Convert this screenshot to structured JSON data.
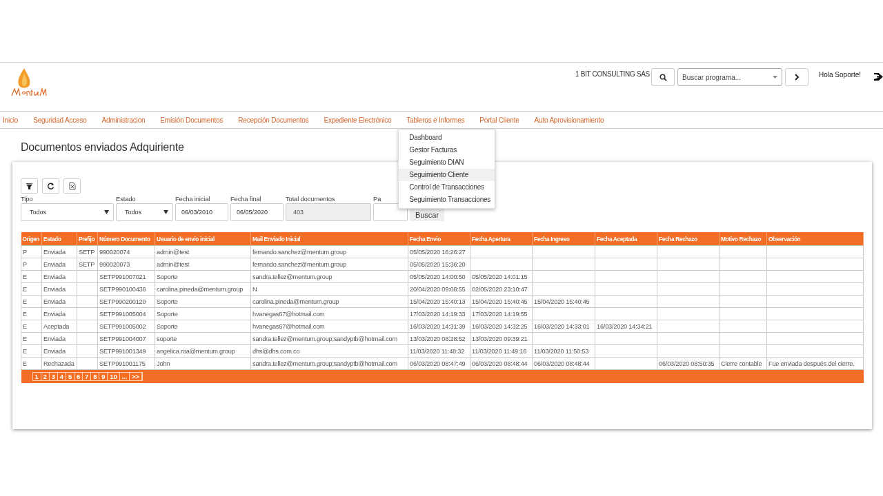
{
  "header": {
    "company": "1 BIT CONSULTING SAS",
    "search": {
      "placeholder": "Buscar programa..."
    },
    "greeting": "Hola Soporte!"
  },
  "nav": {
    "items": [
      {
        "label": "Inicio"
      },
      {
        "label": "Seguridad Acceso"
      },
      {
        "label": "Administracion"
      },
      {
        "label": "Emisión Documentos"
      },
      {
        "label": "Recepción Documentos"
      },
      {
        "label": "Expediente Electrónico"
      },
      {
        "label": "Tableros e Informes",
        "children": [
          {
            "label": "Dashboard",
            "selected": false
          },
          {
            "label": "Gestor Facturas",
            "selected": false
          },
          {
            "label": "Seguimiento DIAN",
            "selected": false
          },
          {
            "label": "Seguimiento Cliente",
            "selected": true
          },
          {
            "label": "Control de Transacciones",
            "selected": false
          },
          {
            "label": "Seguimiento Transacciones",
            "selected": false
          }
        ]
      },
      {
        "label": "Portal Cliente"
      },
      {
        "label": "Auto Aprovisionamiento"
      }
    ]
  },
  "page_title": "Documentos enviados Adquiriente",
  "filters": [
    {
      "kind": "select",
      "label": "Tipo",
      "value": "Todos"
    },
    {
      "kind": "select",
      "label": "Estado",
      "value": "Todos"
    },
    {
      "kind": "date",
      "label": "Fecha inicial",
      "value": "06/03/2010"
    },
    {
      "kind": "date",
      "label": "Fecha final",
      "value": "06/05/2020"
    },
    {
      "kind": "readonly",
      "label": "Total documentos",
      "value": "403"
    },
    {
      "kind": "text",
      "label": "Pa"
    }
  ],
  "search_button": "Buscar",
  "table": {
    "columns": [
      "Origen",
      "Estado",
      "Prefijo",
      "Número Documento",
      "Usuario de envio inicial",
      "Mail Enviado Inicial",
      "Fecha Envio",
      "Fecha Apertura",
      "Fecha Ingreso",
      "Fecha Aceptada",
      "Fecha Rechazo",
      "Motivo Rechazo",
      "Observación"
    ],
    "rows": [
      [
        "P",
        "Enviada",
        "SETP",
        "990020074",
        "admin@test",
        "fernando.sanchez@mentum.group",
        "05/05/2020 16:26:27",
        "",
        "",
        "",
        "",
        "",
        ""
      ],
      [
        "P",
        "Enviada",
        "SETP",
        "990020073",
        "admin@test",
        "fernando.sanchez@mentum.group",
        "05/05/2020 15:36:20",
        "",
        "",
        "",
        "",
        "",
        ""
      ],
      [
        "E",
        "Enviada",
        "",
        "SETP991007021",
        "Soporte",
        "sandra.tellez@mentum.group",
        "05/05/2020 14:00:50",
        "05/05/2020 14:01:15",
        "",
        "",
        "",
        "",
        ""
      ],
      [
        "E",
        "Enviada",
        "",
        "SETP990100436",
        "carolina.pineda@mentum.group",
        "N",
        "20/04/2020 09:06:55",
        "02/05/2020 23:10:47",
        "",
        "",
        "",
        "",
        ""
      ],
      [
        "E",
        "Enviada",
        "",
        "SETP990200120",
        "Soporte",
        "carolina.pineda@mentum.group",
        "15/04/2020 15:40:13",
        "15/04/2020 15:40:45",
        "15/04/2020 15:40:45",
        "",
        "",
        "",
        ""
      ],
      [
        "E",
        "Enviada",
        "",
        "SETP991005004",
        "Soporte",
        "hvanegas67@hotmail.com",
        "17/03/2020 14:19:33",
        "17/03/2020 14:19:55",
        "",
        "",
        "",
        "",
        ""
      ],
      [
        "E",
        "Aceptada",
        "",
        "SETP991005002",
        "Soporte",
        "hvanegas67@hotmail.com",
        "16/03/2020 14:31:39",
        "16/03/2020 14:32:25",
        "16/03/2020 14:33:01",
        "16/03/2020 14:34:21",
        "",
        "",
        ""
      ],
      [
        "E",
        "Enviada",
        "",
        "SETP991004007",
        "soporte",
        "sandra.tellez@mentum.group;sandyptb@hotmail.com",
        "13/03/2020 08:28:52",
        "13/03/2020 09:39:21",
        "",
        "",
        "",
        "",
        ""
      ],
      [
        "E",
        "Enviada",
        "",
        "SETP991001349",
        "angelica.roa@mentum.group",
        "dhs@dhs.com.co",
        "11/03/2020 11:48:32",
        "11/03/2020 11:49:18",
        "11/03/2020 11:50:53",
        "",
        "",
        "",
        ""
      ],
      [
        "E",
        "Rechazada",
        "",
        "SETP991001175",
        "John",
        "sandra.tellez@mentum.group;sandyptb@hotmail.com",
        "06/03/2020 08:47:49",
        "06/03/2020 08:48:44",
        "06/03/2020 08:48:44",
        "",
        "06/03/2020 08:50:35",
        "Cierre contable",
        "Fue enviada después del cierre."
      ]
    ],
    "pages": [
      "1",
      "2",
      "3",
      "4",
      "5",
      "6",
      "7",
      "8",
      "9",
      "10",
      "...",
      ">>"
    ]
  }
}
